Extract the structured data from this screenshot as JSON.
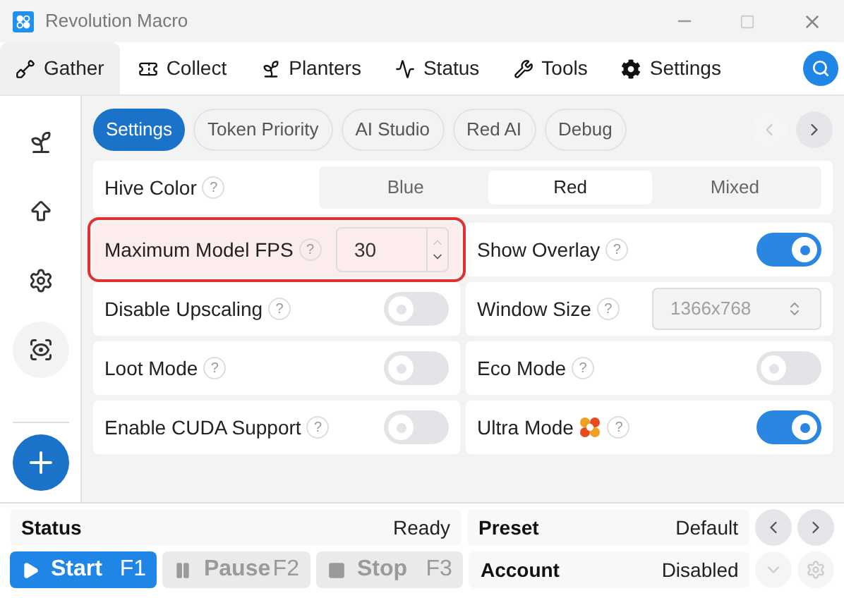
{
  "window": {
    "title": "Revolution Macro"
  },
  "tabs": [
    {
      "label": "Gather",
      "kind": "shovel",
      "selected": true
    },
    {
      "label": "Collect",
      "kind": "ticket",
      "selected": false
    },
    {
      "label": "Planters",
      "kind": "sprout",
      "selected": false
    },
    {
      "label": "Status",
      "kind": "pulse",
      "selected": false
    },
    {
      "label": "Tools",
      "kind": "wrench",
      "selected": false
    },
    {
      "label": "Settings",
      "kind": "gear",
      "selected": false
    }
  ],
  "sidebar": {
    "items": [
      {
        "kind": "sprout",
        "selected": false
      },
      {
        "kind": "arrow",
        "selected": false
      },
      {
        "kind": "gear",
        "selected": false
      },
      {
        "kind": "eye",
        "selected": true
      }
    ]
  },
  "subtabs": [
    {
      "label": "Settings",
      "selected": true
    },
    {
      "label": "Token Priority",
      "selected": false
    },
    {
      "label": "AI Studio",
      "selected": false
    },
    {
      "label": "Red AI",
      "selected": false
    },
    {
      "label": "Debug",
      "selected": false
    }
  ],
  "hive_color": {
    "label": "Hive Color",
    "help": "?",
    "options": [
      {
        "label": "Blue",
        "selected": false
      },
      {
        "label": "Red",
        "selected": true
      },
      {
        "label": "Mixed",
        "selected": false
      }
    ]
  },
  "settings": [
    {
      "kind": "number",
      "label": "Maximum Model FPS",
      "help": "?",
      "value": "30",
      "highlighted": true
    },
    {
      "kind": "toggle",
      "label": "Show Overlay",
      "help": "?",
      "on": true,
      "highlighted": false
    },
    {
      "kind": "toggle",
      "label": "Disable Upscaling",
      "help": "?",
      "on": false,
      "highlighted": false
    },
    {
      "kind": "select",
      "label": "Window Size",
      "help": "?",
      "value": "1366x768",
      "disabled": true,
      "highlighted": false
    },
    {
      "kind": "toggle",
      "label": "Loot Mode",
      "help": "?",
      "on": false,
      "highlighted": false
    },
    {
      "kind": "toggle",
      "label": "Eco Mode",
      "help": "?",
      "on": false,
      "highlighted": false
    },
    {
      "kind": "toggle",
      "label": "Enable CUDA Support",
      "help": "?",
      "on": false,
      "highlighted": false
    },
    {
      "kind": "toggle",
      "label": "Ultra Mode",
      "help": "?",
      "on": true,
      "highlighted": false,
      "decorated": true
    }
  ],
  "status": {
    "label": "Status",
    "value": "Ready"
  },
  "preset": {
    "label": "Preset",
    "value": "Default"
  },
  "account": {
    "label": "Account",
    "value": "Disabled"
  },
  "controls": [
    {
      "kind": "start",
      "label": "Start",
      "key": "F1",
      "disabled": false
    },
    {
      "kind": "pause",
      "label": "Pause",
      "key": "F2",
      "disabled": true
    },
    {
      "kind": "stop",
      "label": "Stop",
      "key": "F3",
      "disabled": true
    }
  ]
}
